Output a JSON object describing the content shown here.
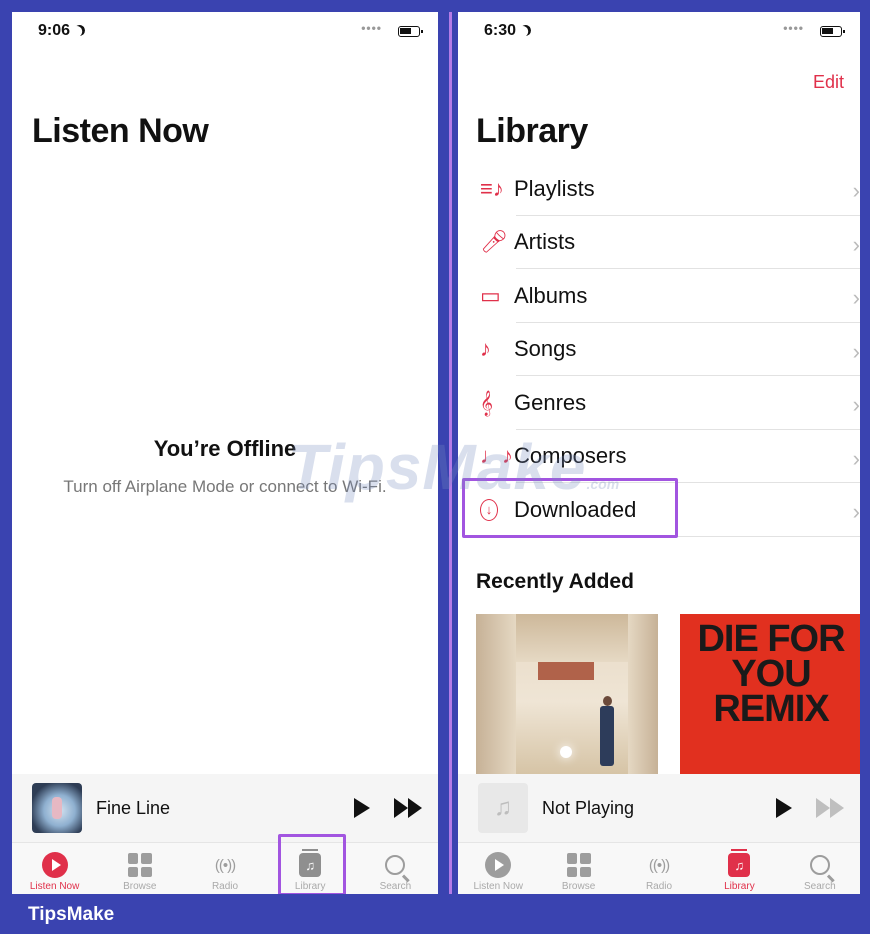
{
  "brand": "TipsMake",
  "watermark": {
    "text": "TipsMake",
    "suffix": ".com"
  },
  "left": {
    "status_time": "9:06",
    "title": "Listen Now",
    "offline_title": "You’re Offline",
    "offline_subtitle": "Turn off Airplane Mode or connect to Wi-Fi.",
    "mini_player": {
      "title": "Fine Line"
    },
    "tabs": [
      {
        "label": "Listen Now",
        "icon": "listen-now-icon"
      },
      {
        "label": "Browse",
        "icon": "browse-icon"
      },
      {
        "label": "Radio",
        "icon": "radio-icon"
      },
      {
        "label": "Library",
        "icon": "library-icon"
      },
      {
        "label": "Search",
        "icon": "search-icon"
      }
    ],
    "active_tab": "Listen Now"
  },
  "right": {
    "status_time": "6:30",
    "edit_label": "Edit",
    "title": "Library",
    "items": [
      {
        "label": "Playlists",
        "icon": "playlists-icon"
      },
      {
        "label": "Artists",
        "icon": "artists-icon"
      },
      {
        "label": "Albums",
        "icon": "albums-icon"
      },
      {
        "label": "Songs",
        "icon": "songs-icon"
      },
      {
        "label": "Genres",
        "icon": "genres-icon"
      },
      {
        "label": "Composers",
        "icon": "composers-icon"
      },
      {
        "label": "Downloaded",
        "icon": "downloaded-icon"
      }
    ],
    "recently_added_title": "Recently Added",
    "album2_text": [
      "DIE FOR",
      "YOU",
      "REMIX"
    ],
    "mini_player": {
      "title": "Not Playing"
    },
    "tabs": [
      {
        "label": "Listen Now",
        "icon": "listen-now-icon"
      },
      {
        "label": "Browse",
        "icon": "browse-icon"
      },
      {
        "label": "Radio",
        "icon": "radio-icon"
      },
      {
        "label": "Library",
        "icon": "library-icon"
      },
      {
        "label": "Search",
        "icon": "search-icon"
      }
    ],
    "active_tab": "Library"
  },
  "colors": {
    "accent": "#e0304a",
    "highlight": "#a255e0",
    "brand_bar": "#3a43b0"
  }
}
